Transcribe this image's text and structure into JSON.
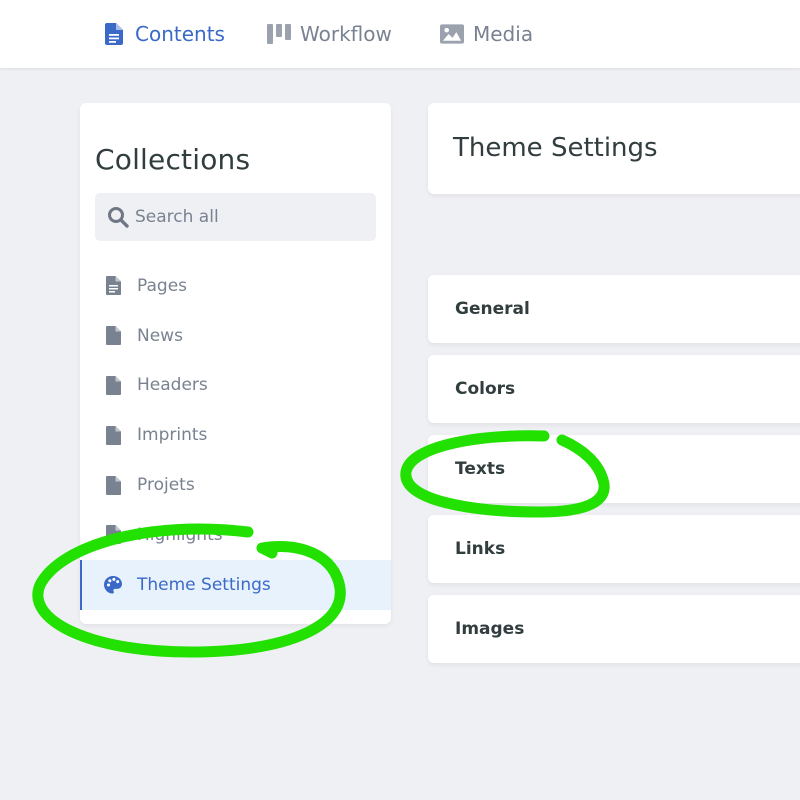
{
  "topnav": {
    "items": [
      {
        "label": "Contents",
        "icon": "document-icon"
      },
      {
        "label": "Workflow",
        "icon": "kanban-icon"
      },
      {
        "label": "Media",
        "icon": "image-icon"
      }
    ],
    "active": "Contents"
  },
  "sidebar": {
    "title": "Collections",
    "search_placeholder": "Search all",
    "items": [
      {
        "label": "Pages",
        "icon": "page-lines-icon"
      },
      {
        "label": "News",
        "icon": "page-icon"
      },
      {
        "label": "Headers",
        "icon": "page-icon"
      },
      {
        "label": "Imprints",
        "icon": "page-icon"
      },
      {
        "label": "Projets",
        "icon": "page-icon"
      },
      {
        "label": "Highlights",
        "icon": "page-icon"
      },
      {
        "label": "Theme Settings",
        "icon": "palette-icon"
      }
    ],
    "active": "Theme Settings"
  },
  "main": {
    "title": "Theme Settings",
    "cards": [
      {
        "label": "General"
      },
      {
        "label": "Colors"
      },
      {
        "label": "Texts"
      },
      {
        "label": "Links"
      },
      {
        "label": "Images"
      }
    ]
  },
  "colors": {
    "accent": "#3a69c7",
    "annotation": "#22e000",
    "background": "#eff0f4",
    "active_bg": "#e8f2fd"
  }
}
